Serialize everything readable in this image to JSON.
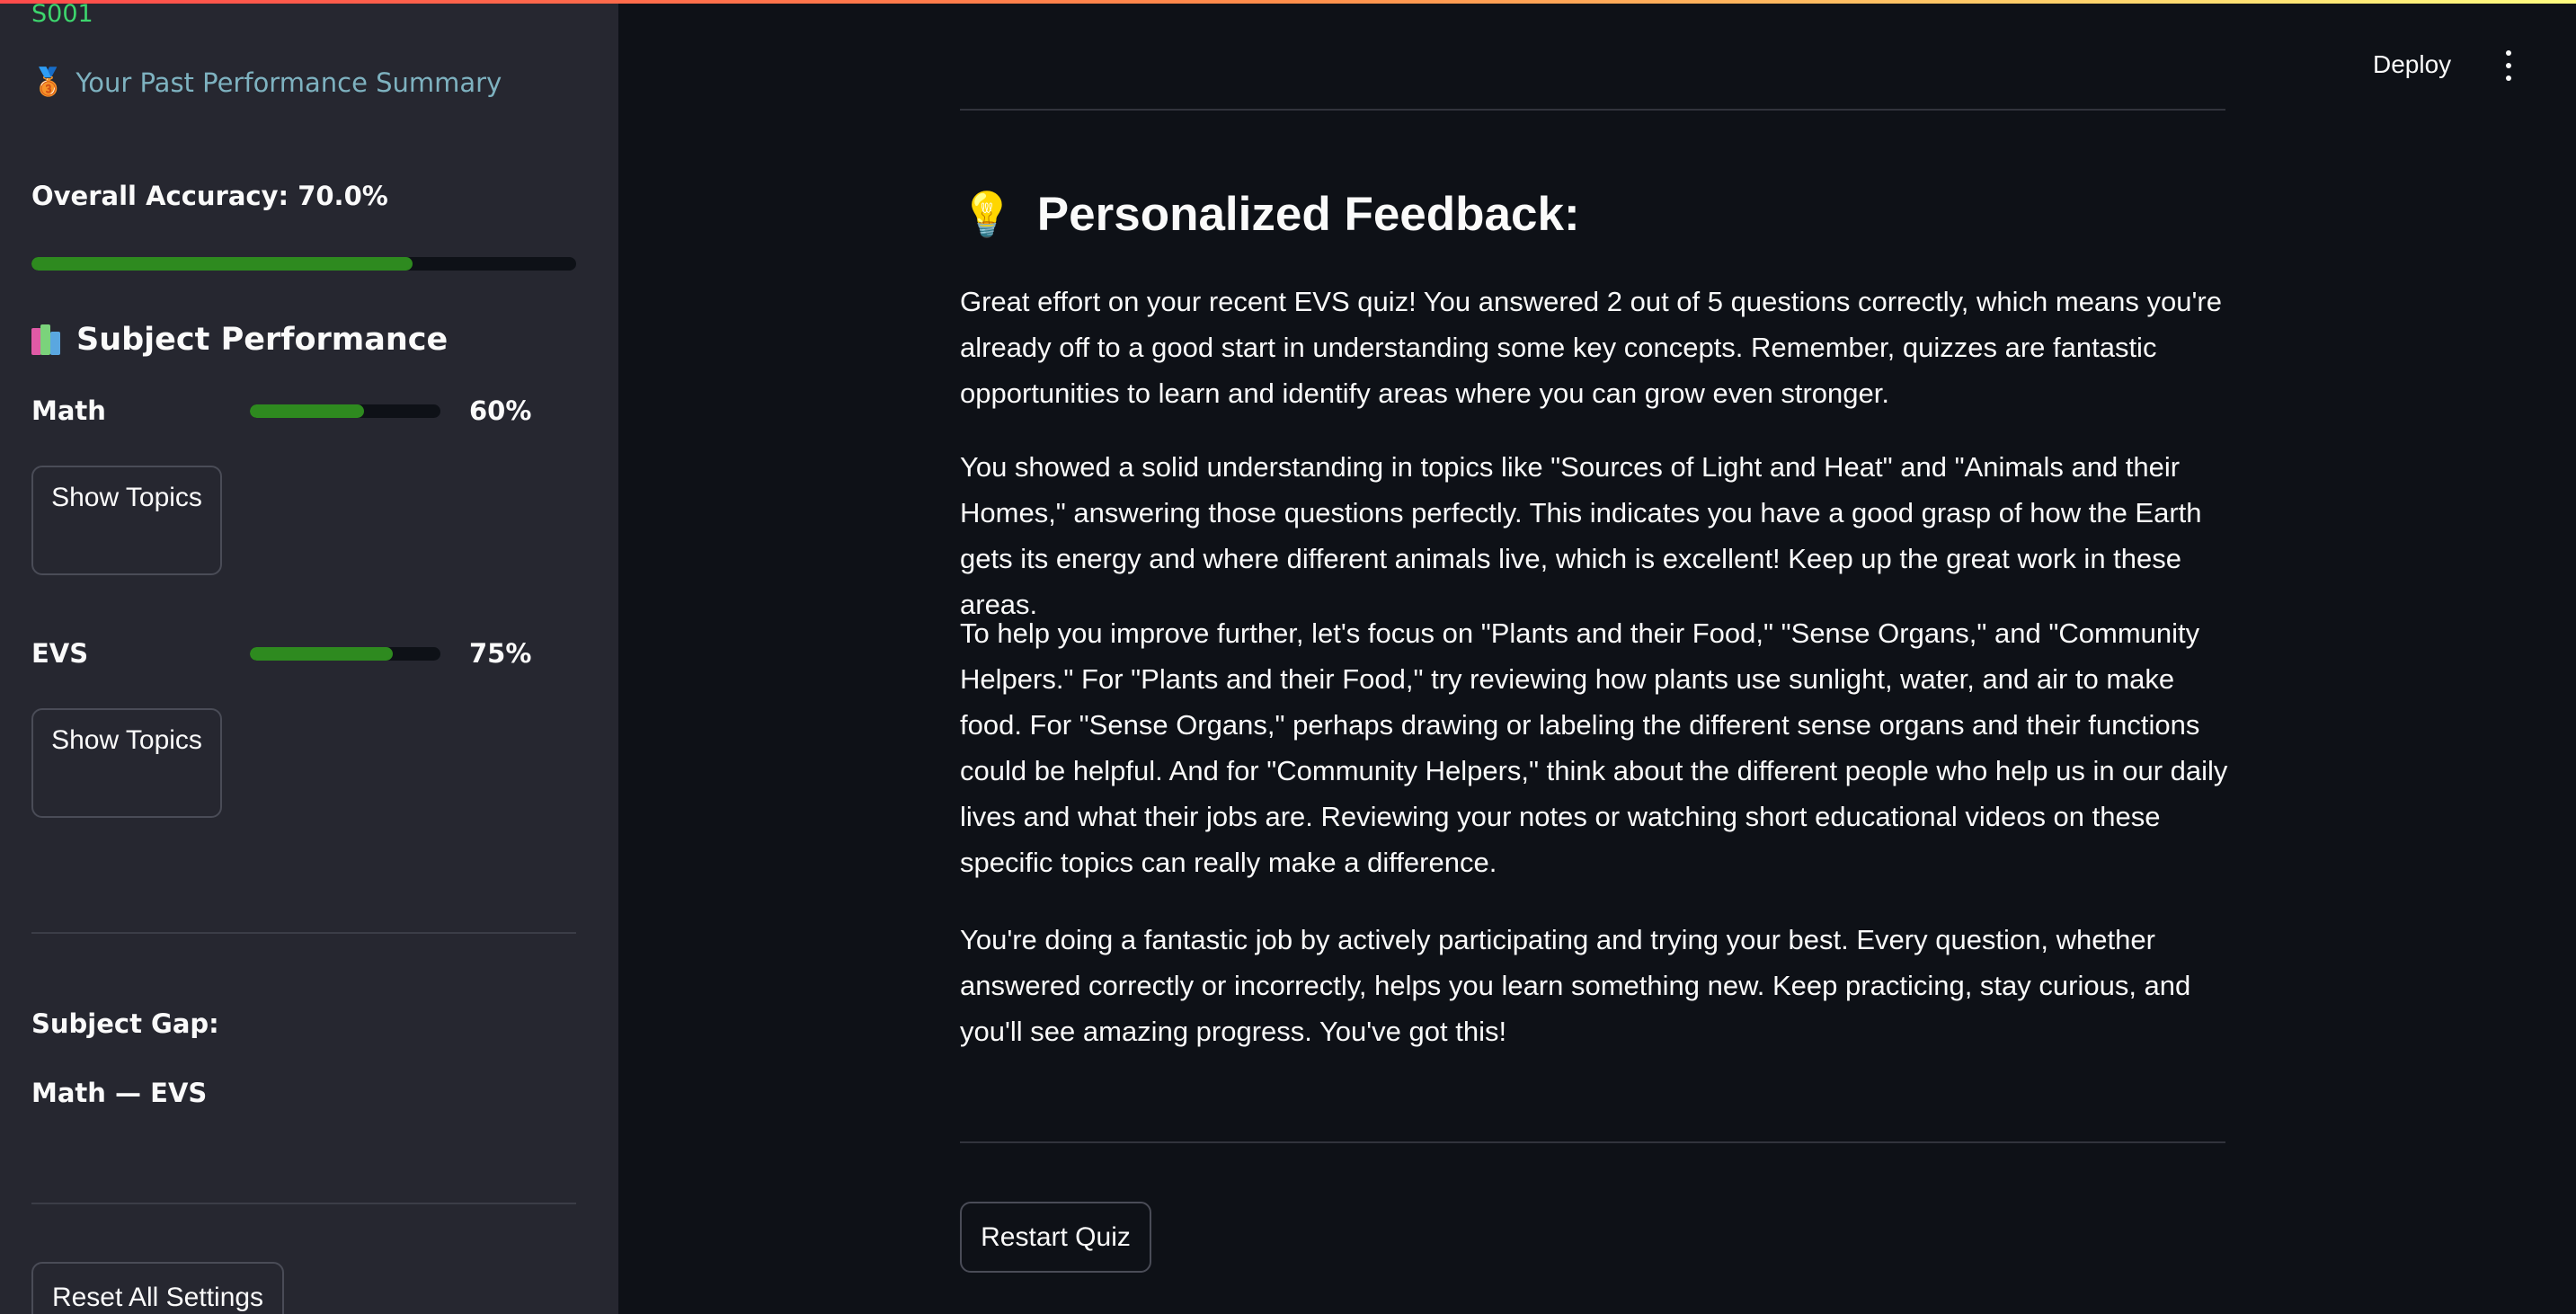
{
  "sidebar": {
    "student_id": "S001",
    "past_summary": "Your Past Performance Summary",
    "overall_accuracy_label": "Overall Accuracy: 70.0%",
    "overall_accuracy_value": 0.7,
    "subject_performance_heading": "Subject Performance",
    "subjects": [
      {
        "name": "Math",
        "percent_label": "60%",
        "value": 0.6,
        "button_label": "Show Topics"
      },
      {
        "name": "EVS",
        "percent_label": "75%",
        "value": 0.75,
        "button_label": "Show Topics"
      }
    ],
    "subject_gap_label": "Subject Gap:",
    "subject_gap_value": "Math — EVS",
    "reset_button": "Reset All Settings"
  },
  "header": {
    "deploy": "Deploy"
  },
  "main": {
    "feedback_title": "Personalized Feedback:",
    "paragraphs": [
      "Great effort on your recent EVS quiz! You answered 2 out of 5 questions correctly, which means you're already off to a good start in understanding some key concepts. Remember, quizzes are fantastic opportunities to learn and identify areas where you can grow even stronger.",
      "You showed a solid understanding in topics like \"Sources of Light and Heat\" and \"Animals and their Homes,\" answering those questions perfectly. This indicates you have a good grasp of how the Earth gets its energy and where different animals live, which is excellent! Keep up the great work in these areas.",
      "To help you improve further, let's focus on \"Plants and their Food,\" \"Sense Organs,\" and \"Community Helpers.\" For \"Plants and their Food,\" try reviewing how plants use sunlight, water, and air to make food. For \"Sense Organs,\" perhaps drawing or labeling the different sense organs and their functions could be helpful. And for \"Community Helpers,\" think about the different people who help us in our daily lives and what their jobs are. Reviewing your notes or watching short educational videos on these specific topics can really make a difference.",
      "You're doing a fantastic job by actively participating and trying your best. Every question, whether answered correctly or incorrectly, helps you learn something new. Keep practicing, stay curious, and you'll see amazing progress. You've got this!"
    ],
    "restart_button": "Restart Quiz"
  },
  "colors": {
    "progress": "#2e8a1f",
    "sidebar_bg": "#262730",
    "main_bg": "#0e1117",
    "student_id": "#3dd56d",
    "summary_link": "#7eb2c0"
  },
  "icons": {
    "medal": "medal-icon",
    "books": "books-icon",
    "bulb": "lightbulb-icon",
    "menu": "kebab-menu-icon"
  }
}
